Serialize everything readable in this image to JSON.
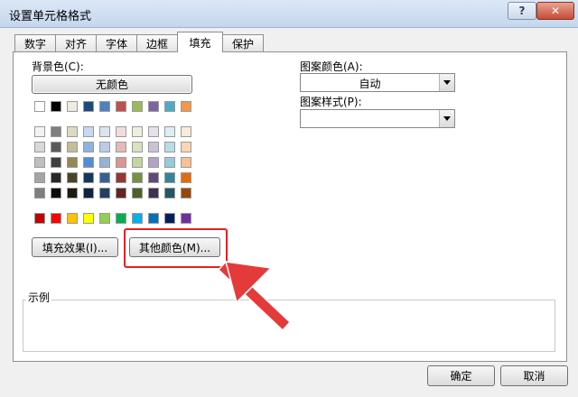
{
  "window": {
    "title": "设置单元格格式"
  },
  "tabs": [
    {
      "label": "数字"
    },
    {
      "label": "对齐"
    },
    {
      "label": "字体"
    },
    {
      "label": "边框"
    },
    {
      "label": "填充"
    },
    {
      "label": "保护"
    }
  ],
  "active_tab": "填充",
  "fill": {
    "background_label": "背景色(C):",
    "no_color_label": "无颜色",
    "palette_top": [
      "#ffffff",
      "#000000",
      "#eeece1",
      "#1f497d",
      "#4f81bd",
      "#c0504d",
      "#9bbb59",
      "#8064a2",
      "#4bacc6",
      "#f79646"
    ],
    "palette_tints": [
      [
        "#f2f2f2",
        "#7f7f7f",
        "#ddd9c3",
        "#c6d9f0",
        "#dbe5f1",
        "#f2dcdb",
        "#ebf1dd",
        "#e5e0ec",
        "#dbeef3",
        "#fdeada"
      ],
      [
        "#d8d8d8",
        "#595959",
        "#c4bd97",
        "#8db3e2",
        "#b8cce4",
        "#e5b9b7",
        "#d7e3bc",
        "#ccc1d9",
        "#b7dde8",
        "#fbd5b5"
      ],
      [
        "#bfbfbf",
        "#3f3f3f",
        "#938953",
        "#548dd4",
        "#95b3d7",
        "#d99694",
        "#c3d69b",
        "#b2a2c7",
        "#92cddc",
        "#fac08f"
      ],
      [
        "#a5a5a5",
        "#262626",
        "#494429",
        "#17365d",
        "#366092",
        "#953734",
        "#76923c",
        "#5f497a",
        "#31859b",
        "#e36c09"
      ],
      [
        "#7f7f7f",
        "#0c0c0c",
        "#1d1b10",
        "#0f243e",
        "#244061",
        "#632423",
        "#4f6128",
        "#3f3151",
        "#205867",
        "#974806"
      ]
    ],
    "palette_standard": [
      "#c00000",
      "#ff0000",
      "#ffc000",
      "#ffff00",
      "#92d050",
      "#00b050",
      "#00b0f0",
      "#0070c0",
      "#002060",
      "#7030a0"
    ],
    "fill_effects_label": "填充效果(I)...",
    "more_colors_label": "其他颜色(M)...",
    "pattern_color_label": "图案颜色(A):",
    "pattern_color_value": "自动",
    "pattern_style_label": "图案样式(P):",
    "pattern_style_value": "",
    "sample_label": "示例"
  },
  "footer": {
    "ok_label": "确定",
    "cancel_label": "取消"
  },
  "colors": {
    "highlight": "#e02121",
    "arrow": "#e53a3a"
  }
}
